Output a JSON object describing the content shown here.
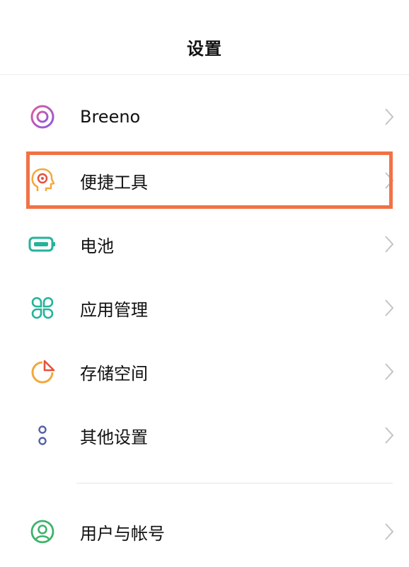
{
  "header": {
    "title": "设置"
  },
  "items": [
    {
      "label": "Breeno",
      "icon": "breeno-icon"
    },
    {
      "label": "便捷工具",
      "icon": "convenience-tools-icon"
    },
    {
      "label": "电池",
      "icon": "battery-icon"
    },
    {
      "label": "应用管理",
      "icon": "app-management-icon"
    },
    {
      "label": "存储空间",
      "icon": "storage-icon"
    },
    {
      "label": "其他设置",
      "icon": "other-settings-icon"
    },
    {
      "label": "用户与帐号",
      "icon": "user-account-icon"
    }
  ],
  "colors": {
    "highlight": "#f07246",
    "breeno": "#b05ad6",
    "tools": "#f2a93b",
    "battery": "#24b39a",
    "apps": "#24b39a",
    "storage": "#f2a93b",
    "other": "#5560a8",
    "user": "#3db36b"
  }
}
